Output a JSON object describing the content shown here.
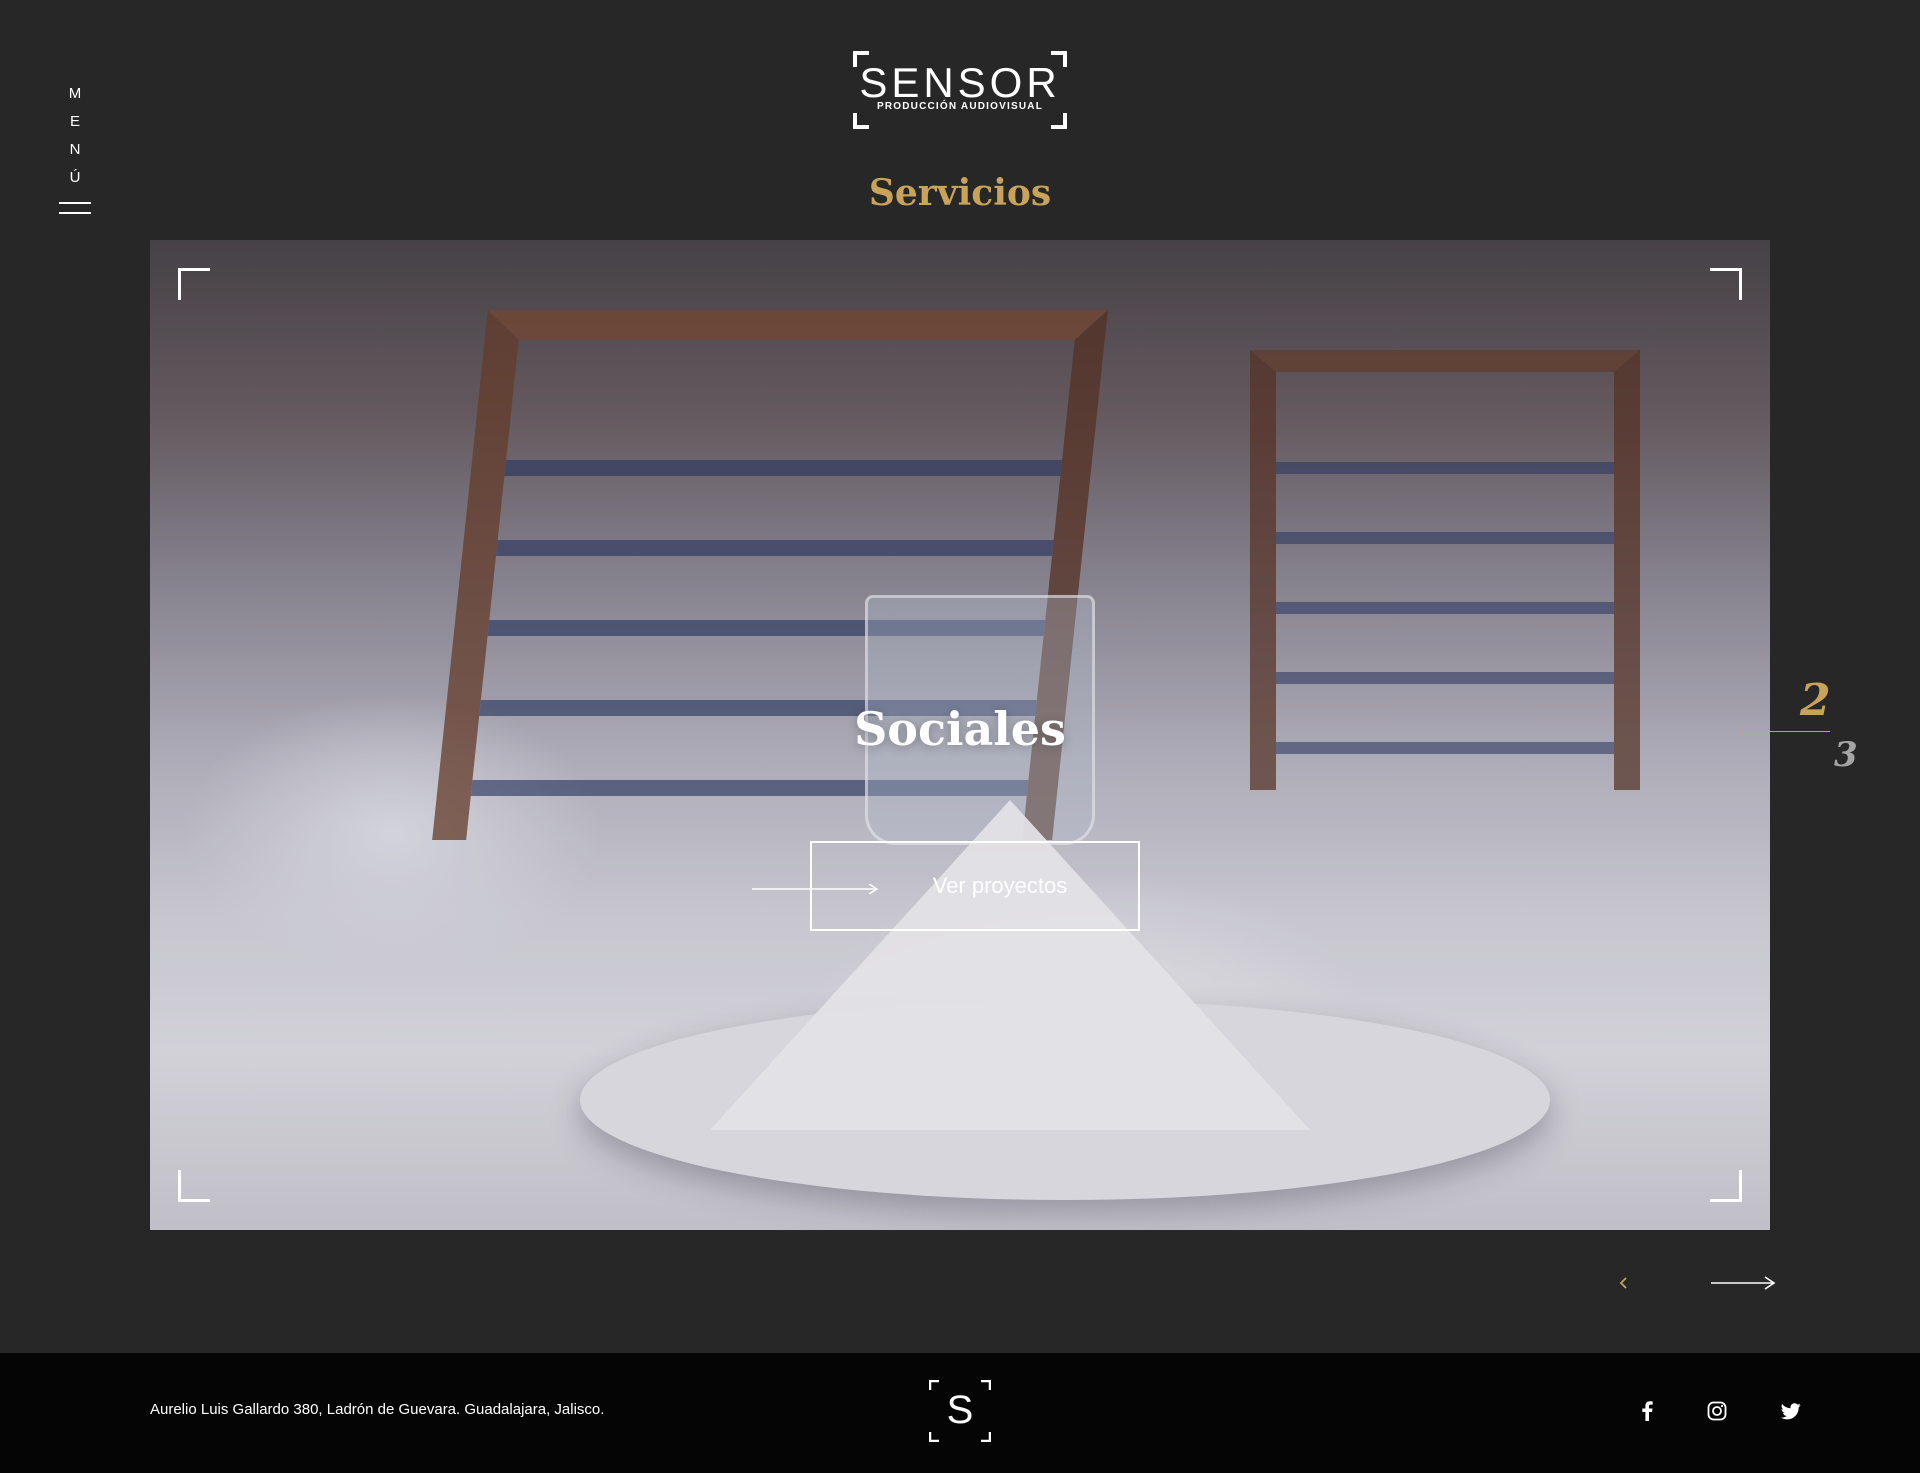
{
  "menu": {
    "letters": [
      "M",
      "E",
      "N",
      "Ú"
    ]
  },
  "logo": {
    "word": "SENSOR",
    "subtitle": "PRODUCCIÓN AUDIOVISUAL"
  },
  "section": {
    "title": "Servicios"
  },
  "slide": {
    "title": "Sociales",
    "cta_label": "Ver proyectos"
  },
  "pager": {
    "current": "2",
    "total": "3"
  },
  "footer": {
    "address": "Aurelio Luis Gallardo 380, Ladrón de Guevara. Guadalajara, Jalisco.",
    "logo_letter": "S",
    "social": [
      "facebook-icon",
      "instagram-icon",
      "twitter-icon"
    ]
  },
  "colors": {
    "background": "#272727",
    "accent": "#c9a35a",
    "footer": "#050505",
    "muted": "#a5a5a5"
  }
}
